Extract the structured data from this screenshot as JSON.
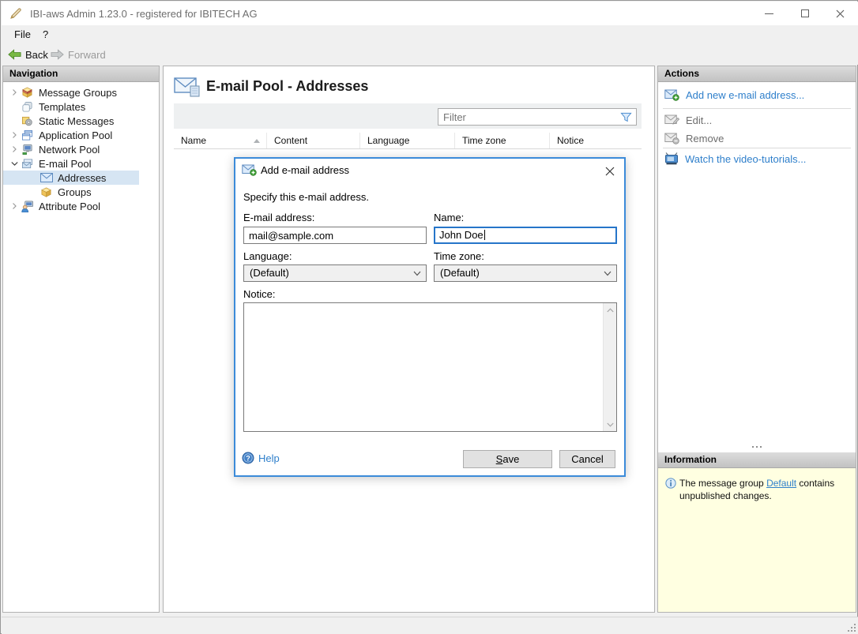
{
  "window": {
    "title": "IBI-aws Admin 1.23.0 - registered for IBITECH AG",
    "controls": [
      "minimize-icon",
      "maximize-icon",
      "close-icon"
    ]
  },
  "menu": {
    "items": [
      "File",
      "?"
    ]
  },
  "toolbar": {
    "back_label": "Back",
    "forward_label": "Forward",
    "back_icon": "arrow-left-green-icon",
    "forward_icon": "arrow-right-gray-icon",
    "forward_enabled": false
  },
  "navigation": {
    "header": "Navigation",
    "items": [
      {
        "label": "Message Groups",
        "icon": "package-stack-icon",
        "chevron": "collapsed",
        "level": 0,
        "selected": false
      },
      {
        "label": "Templates",
        "icon": "templates-icon",
        "chevron": "none",
        "level": 0,
        "selected": false
      },
      {
        "label": "Static Messages",
        "icon": "gear-box-icon",
        "chevron": "none",
        "level": 0,
        "selected": false
      },
      {
        "label": "Application Pool",
        "icon": "app-windows-icon",
        "chevron": "collapsed",
        "level": 0,
        "selected": false
      },
      {
        "label": "Network Pool",
        "icon": "network-icon",
        "chevron": "collapsed",
        "level": 0,
        "selected": false
      },
      {
        "label": "E-mail Pool",
        "icon": "envelope-stack-icon",
        "chevron": "expanded",
        "level": 0,
        "selected": false
      },
      {
        "label": "Addresses",
        "icon": "envelope-icon",
        "chevron": "none",
        "level": 1,
        "selected": true
      },
      {
        "label": "Groups",
        "icon": "package-icon",
        "chevron": "none",
        "level": 1,
        "selected": false
      },
      {
        "label": "Attribute Pool",
        "icon": "person-computer-icon",
        "chevron": "collapsed",
        "level": 0,
        "selected": false
      }
    ]
  },
  "main": {
    "title": "E-mail Pool - Addresses",
    "title_icon": "envelope-page-icon",
    "filter": {
      "placeholder": "Filter",
      "icon": "funnel-icon"
    },
    "table": {
      "columns": [
        "Name",
        "Content",
        "Language",
        "Time zone",
        "Notice"
      ],
      "sort": {
        "column": "Name",
        "direction": "ascending"
      },
      "rows": []
    }
  },
  "actions": {
    "header": "Actions",
    "items": [
      {
        "label": "Add new e-mail address...",
        "icon": "envelope-add-icon",
        "enabled": true
      },
      {
        "label": "Edit...",
        "icon": "envelope-edit-icon",
        "enabled": false
      },
      {
        "label": "Remove",
        "icon": "envelope-remove-icon",
        "enabled": false
      },
      {
        "label": "Watch the video-tutorials...",
        "icon": "tv-icon",
        "enabled": true
      }
    ]
  },
  "information": {
    "header": "Information",
    "icon": "info-icon",
    "text_before": "The message group ",
    "link_label": "Default",
    "text_after": " contains unpublished changes."
  },
  "dialog": {
    "title": "Add e-mail address",
    "title_icon": "envelope-add-icon",
    "description": "Specify this e-mail address.",
    "fields": {
      "email": {
        "label": "E-mail address:",
        "value": "mail@sample.com"
      },
      "name": {
        "label": "Name:",
        "value": "John Doe",
        "focused": true
      },
      "language": {
        "label": "Language:",
        "value": "(Default)"
      },
      "timezone": {
        "label": "Time zone:",
        "value": "(Default)"
      },
      "notice": {
        "label": "Notice:",
        "value": ""
      }
    },
    "help_label": "Help",
    "save_label": "Save",
    "cancel_label": "Cancel"
  },
  "colors": {
    "accent": "#3c8bd9",
    "link": "#2e7fcb",
    "selection": "#d6e5f3",
    "info_background": "#ffffe1",
    "focused_field_border": "#2675c9"
  }
}
